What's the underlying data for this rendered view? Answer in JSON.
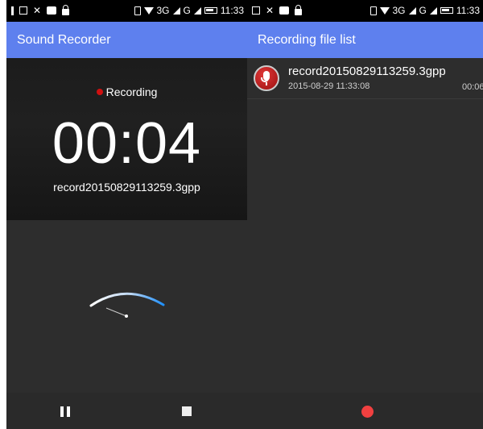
{
  "left_screen": {
    "status_time": "11:33",
    "status_network": "3G",
    "status_signal_label": "G",
    "title": "Sound Recorder",
    "recording_status": "Recording",
    "timer": "00:04",
    "filename": "record20150829113259.3gpp",
    "accent_blue": "#5e80ee",
    "record_dot_color": "#d01010"
  },
  "right_screen": {
    "status_time": "11:33",
    "status_network": "3G",
    "status_signal_label": "G",
    "title": "Recording file list",
    "files": [
      {
        "name": "record20150829113259.3gpp",
        "datetime": "2015-08-29 11:33:08",
        "duration": "00:06"
      }
    ],
    "record_button_color": "#f04040"
  },
  "icons": [
    "exclamation-icon",
    "image-icon",
    "missed-call-icon",
    "chat-icon",
    "lock-icon",
    "vibrate-icon",
    "wifi-icon",
    "signal-icon",
    "battery-icon",
    "pause-icon",
    "stop-icon",
    "record-icon",
    "microphone-icon"
  ]
}
